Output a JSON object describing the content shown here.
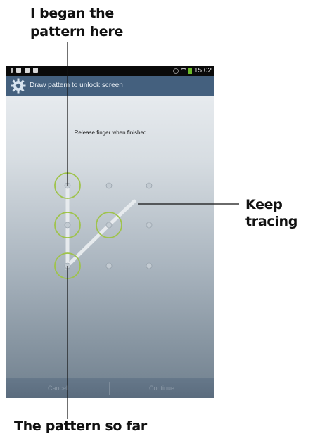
{
  "callouts": {
    "top_line1": "I began the",
    "top_line2": "pattern here",
    "right": "Keep tracing",
    "bottom": "The pattern so far"
  },
  "status_bar": {
    "time": "15:02",
    "battery_color": "#6dbb2a"
  },
  "titlebar": {
    "icon": "gear-icon",
    "title": "Draw pattern to unlock screen"
  },
  "lock_screen": {
    "prompt": "Release finger when finished",
    "grid": {
      "rows": 3,
      "cols": 3
    },
    "selected_dots": [
      [
        0,
        0
      ],
      [
        1,
        0
      ],
      [
        2,
        0
      ],
      [
        1,
        1
      ]
    ],
    "ring_color": "#9fc34b"
  },
  "buttons": {
    "cancel": "Cancel",
    "continue": "Continue"
  }
}
